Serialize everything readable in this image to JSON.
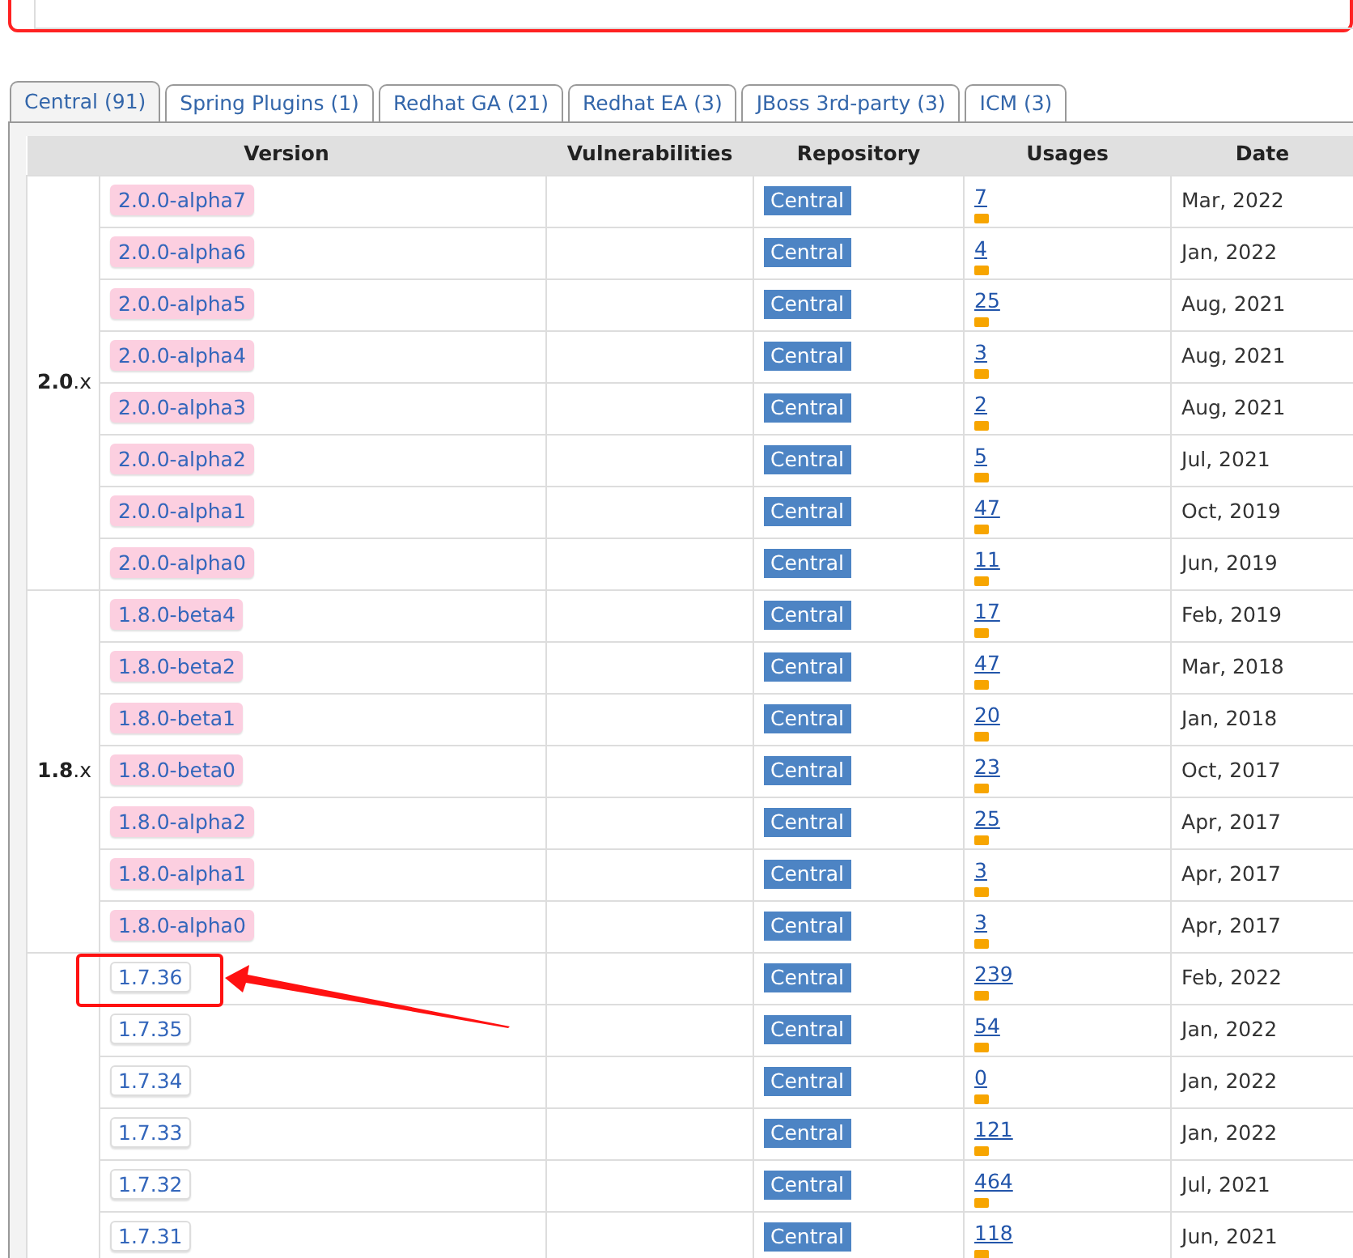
{
  "tabs": [
    {
      "label": "Central (91)",
      "selected": true
    },
    {
      "label": "Spring Plugins (1)",
      "selected": false
    },
    {
      "label": "Redhat GA (21)",
      "selected": false
    },
    {
      "label": "Redhat EA (3)",
      "selected": false
    },
    {
      "label": "JBoss 3rd-party (3)",
      "selected": false
    },
    {
      "label": "ICM (3)",
      "selected": false
    }
  ],
  "table": {
    "columns": [
      "Version",
      "Vulnerabilities",
      "Repository",
      "Usages",
      "Date"
    ],
    "groups": [
      {
        "label": "**2.0**.x",
        "rows": [
          {
            "version": "2.0.0-alpha7",
            "kind": "prerelease",
            "repository": "Central",
            "usages": "7",
            "date": "Mar, 2022",
            "highlighted": false
          },
          {
            "version": "2.0.0-alpha6",
            "kind": "prerelease",
            "repository": "Central",
            "usages": "4",
            "date": "Jan, 2022",
            "highlighted": false
          },
          {
            "version": "2.0.0-alpha5",
            "kind": "prerelease",
            "repository": "Central",
            "usages": "25",
            "date": "Aug, 2021",
            "highlighted": false
          },
          {
            "version": "2.0.0-alpha4",
            "kind": "prerelease",
            "repository": "Central",
            "usages": "3",
            "date": "Aug, 2021",
            "highlighted": false
          },
          {
            "version": "2.0.0-alpha3",
            "kind": "prerelease",
            "repository": "Central",
            "usages": "2",
            "date": "Aug, 2021",
            "highlighted": false
          },
          {
            "version": "2.0.0-alpha2",
            "kind": "prerelease",
            "repository": "Central",
            "usages": "5",
            "date": "Jul, 2021",
            "highlighted": false
          },
          {
            "version": "2.0.0-alpha1",
            "kind": "prerelease",
            "repository": "Central",
            "usages": "47",
            "date": "Oct, 2019",
            "highlighted": false
          },
          {
            "version": "2.0.0-alpha0",
            "kind": "prerelease",
            "repository": "Central",
            "usages": "11",
            "date": "Jun, 2019",
            "highlighted": false
          }
        ]
      },
      {
        "label": "**1.8**.x",
        "rows": [
          {
            "version": "1.8.0-beta4",
            "kind": "prerelease",
            "repository": "Central",
            "usages": "17",
            "date": "Feb, 2019",
            "highlighted": false
          },
          {
            "version": "1.8.0-beta2",
            "kind": "prerelease",
            "repository": "Central",
            "usages": "47",
            "date": "Mar, 2018",
            "highlighted": false
          },
          {
            "version": "1.8.0-beta1",
            "kind": "prerelease",
            "repository": "Central",
            "usages": "20",
            "date": "Jan, 2018",
            "highlighted": false
          },
          {
            "version": "1.8.0-beta0",
            "kind": "prerelease",
            "repository": "Central",
            "usages": "23",
            "date": "Oct, 2017",
            "highlighted": false
          },
          {
            "version": "1.8.0-alpha2",
            "kind": "prerelease",
            "repository": "Central",
            "usages": "25",
            "date": "Apr, 2017",
            "highlighted": false
          },
          {
            "version": "1.8.0-alpha1",
            "kind": "prerelease",
            "repository": "Central",
            "usages": "3",
            "date": "Apr, 2017",
            "highlighted": false
          },
          {
            "version": "1.8.0-alpha0",
            "kind": "prerelease",
            "repository": "Central",
            "usages": "3",
            "date": "Apr, 2017",
            "highlighted": false
          }
        ]
      },
      {
        "rows": [
          {
            "version": "1.7.36",
            "kind": "release",
            "repository": "Central",
            "usages": "239",
            "date": "Feb, 2022",
            "highlighted": true
          },
          {
            "version": "1.7.35",
            "kind": "release",
            "repository": "Central",
            "usages": "54",
            "date": "Jan, 2022",
            "highlighted": false
          },
          {
            "version": "1.7.34",
            "kind": "release",
            "repository": "Central",
            "usages": "0",
            "date": "Jan, 2022",
            "highlighted": false
          },
          {
            "version": "1.7.33",
            "kind": "release",
            "repository": "Central",
            "usages": "121",
            "date": "Jan, 2022",
            "highlighted": false
          },
          {
            "version": "1.7.32",
            "kind": "release",
            "repository": "Central",
            "usages": "464",
            "date": "Jul, 2021",
            "highlighted": false
          },
          {
            "version": "1.7.31",
            "kind": "release",
            "repository": "Central",
            "usages": "118",
            "date": "Jun, 2021",
            "highlighted": false
          }
        ]
      }
    ]
  }
}
